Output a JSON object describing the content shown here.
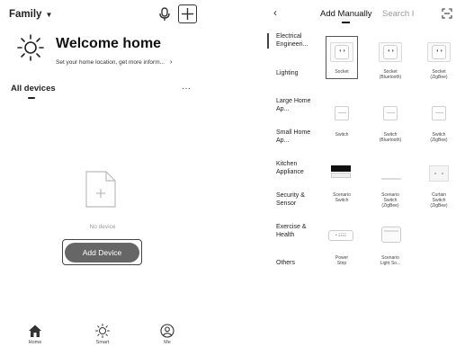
{
  "left": {
    "family_label": "Family",
    "welcome_title": "Welcome home",
    "welcome_subtitle": "Set your home location, get more inform...",
    "welcome_chevron": "›",
    "section_title": "All devices",
    "more_label": "···",
    "empty_text": "No device",
    "add_button_label": "Add Device",
    "tabs": [
      {
        "label": "Home",
        "icon": "home-icon"
      },
      {
        "label": "Smart",
        "icon": "sun-icon"
      },
      {
        "label": "Me",
        "icon": "user-icon"
      }
    ]
  },
  "right": {
    "back_label": "‹",
    "tab_manual": "Add Manually",
    "tab_search": "Search I",
    "categories": [
      "Electrical Engineeri...",
      "Lighting",
      "Large Home Ap...",
      "Small Home Ap...",
      "Kitchen Appliance",
      "Security & Sensor",
      "Exercise & Health",
      "Others"
    ],
    "devices": [
      {
        "name": "Socket",
        "sub": ""
      },
      {
        "name": "Socket",
        "sub": "(Bluetooth)"
      },
      {
        "name": "Socket",
        "sub": "(ZigBee)"
      },
      {
        "name": "Switch",
        "sub": ""
      },
      {
        "name": "Switch",
        "sub": "(Bluetooth)"
      },
      {
        "name": "Switch",
        "sub": "(ZigBee)"
      },
      {
        "name": "Scenario",
        "sub": "Switch"
      },
      {
        "name": "Scenario",
        "sub": "Switch"
      },
      {
        "name": "Curtain",
        "sub": "Switch"
      },
      {
        "name": "Power",
        "sub": "Strip"
      },
      {
        "name": "Scenario",
        "sub": "Light So..."
      }
    ],
    "device_extra": {
      "scenario_zigbee": "(ZigBee)",
      "curtain_zigbee": "(ZigBee)"
    },
    "strip_text": "• ☷☷"
  }
}
